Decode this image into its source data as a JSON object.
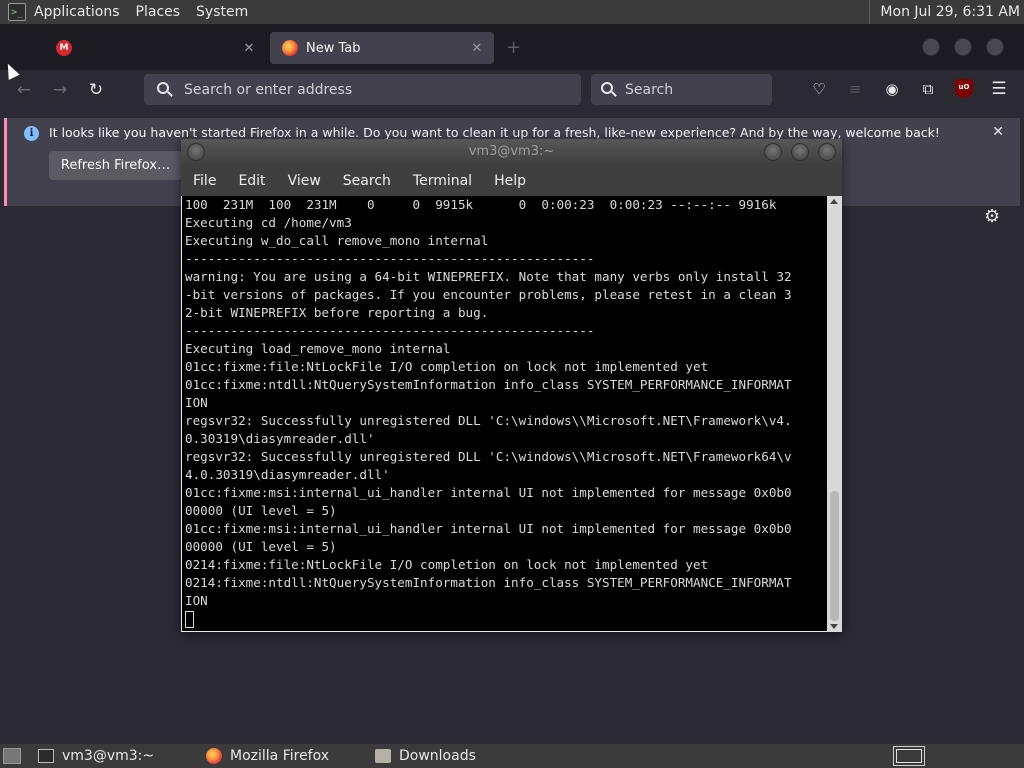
{
  "top_panel": {
    "menus": [
      "Applications",
      "Places",
      "System"
    ],
    "clock": "Mon Jul 29,  6:31 AM"
  },
  "firefox": {
    "tabs": [
      {
        "title": "",
        "favicon": "mega-icon",
        "favicon_text": "M",
        "active": false
      },
      {
        "title": "New Tab",
        "favicon": "firefox-icon",
        "active": true
      }
    ],
    "urlbar_placeholder": "Search or enter address",
    "searchbar_placeholder": "Search",
    "notification": {
      "text": "It looks like you haven't started Firefox in a while. Do you want to clean it up for a fresh, like-new experience? And by the way, welcome back!",
      "button": "Refresh Firefox…"
    },
    "ublock_badge": "uO"
  },
  "terminal": {
    "title": "vm3@vm3:~",
    "menus": [
      "File",
      "Edit",
      "View",
      "Search",
      "Terminal",
      "Help"
    ],
    "lines": [
      "100  231M  100  231M    0     0  9915k      0  0:00:23  0:00:23 --:--:-- 9916k",
      "Executing cd /home/vm3",
      "Executing w_do_call remove_mono internal",
      "------------------------------------------------------",
      "warning: You are using a 64-bit WINEPREFIX. Note that many verbs only install 32",
      "-bit versions of packages. If you encounter problems, please retest in a clean 3",
      "2-bit WINEPREFIX before reporting a bug.",
      "------------------------------------------------------",
      "Executing load_remove_mono internal",
      "01cc:fixme:file:NtLockFile I/O completion on lock not implemented yet",
      "01cc:fixme:ntdll:NtQuerySystemInformation info_class SYSTEM_PERFORMANCE_INFORMAT",
      "ION",
      "regsvr32: Successfully unregistered DLL 'C:\\windows\\\\Microsoft.NET\\Framework\\v4.",
      "0.30319\\diasymreader.dll'",
      "regsvr32: Successfully unregistered DLL 'C:\\windows\\\\Microsoft.NET\\Framework64\\v",
      "4.0.30319\\diasymreader.dll'",
      "01cc:fixme:msi:internal_ui_handler internal UI not implemented for message 0x0b0",
      "00000 (UI level = 5)",
      "01cc:fixme:msi:internal_ui_handler internal UI not implemented for message 0x0b0",
      "00000 (UI level = 5)",
      "0214:fixme:file:NtLockFile I/O completion on lock not implemented yet",
      "0214:fixme:ntdll:NtQuerySystemInformation info_class SYSTEM_PERFORMANCE_INFORMAT",
      "ION"
    ]
  },
  "taskbar": {
    "tasks": [
      {
        "label": "vm3@vm3:~",
        "icon": "terminal-icon"
      },
      {
        "label": "Mozilla Firefox",
        "icon": "firefox-icon"
      },
      {
        "label": "Downloads",
        "icon": "folder-icon"
      }
    ]
  }
}
